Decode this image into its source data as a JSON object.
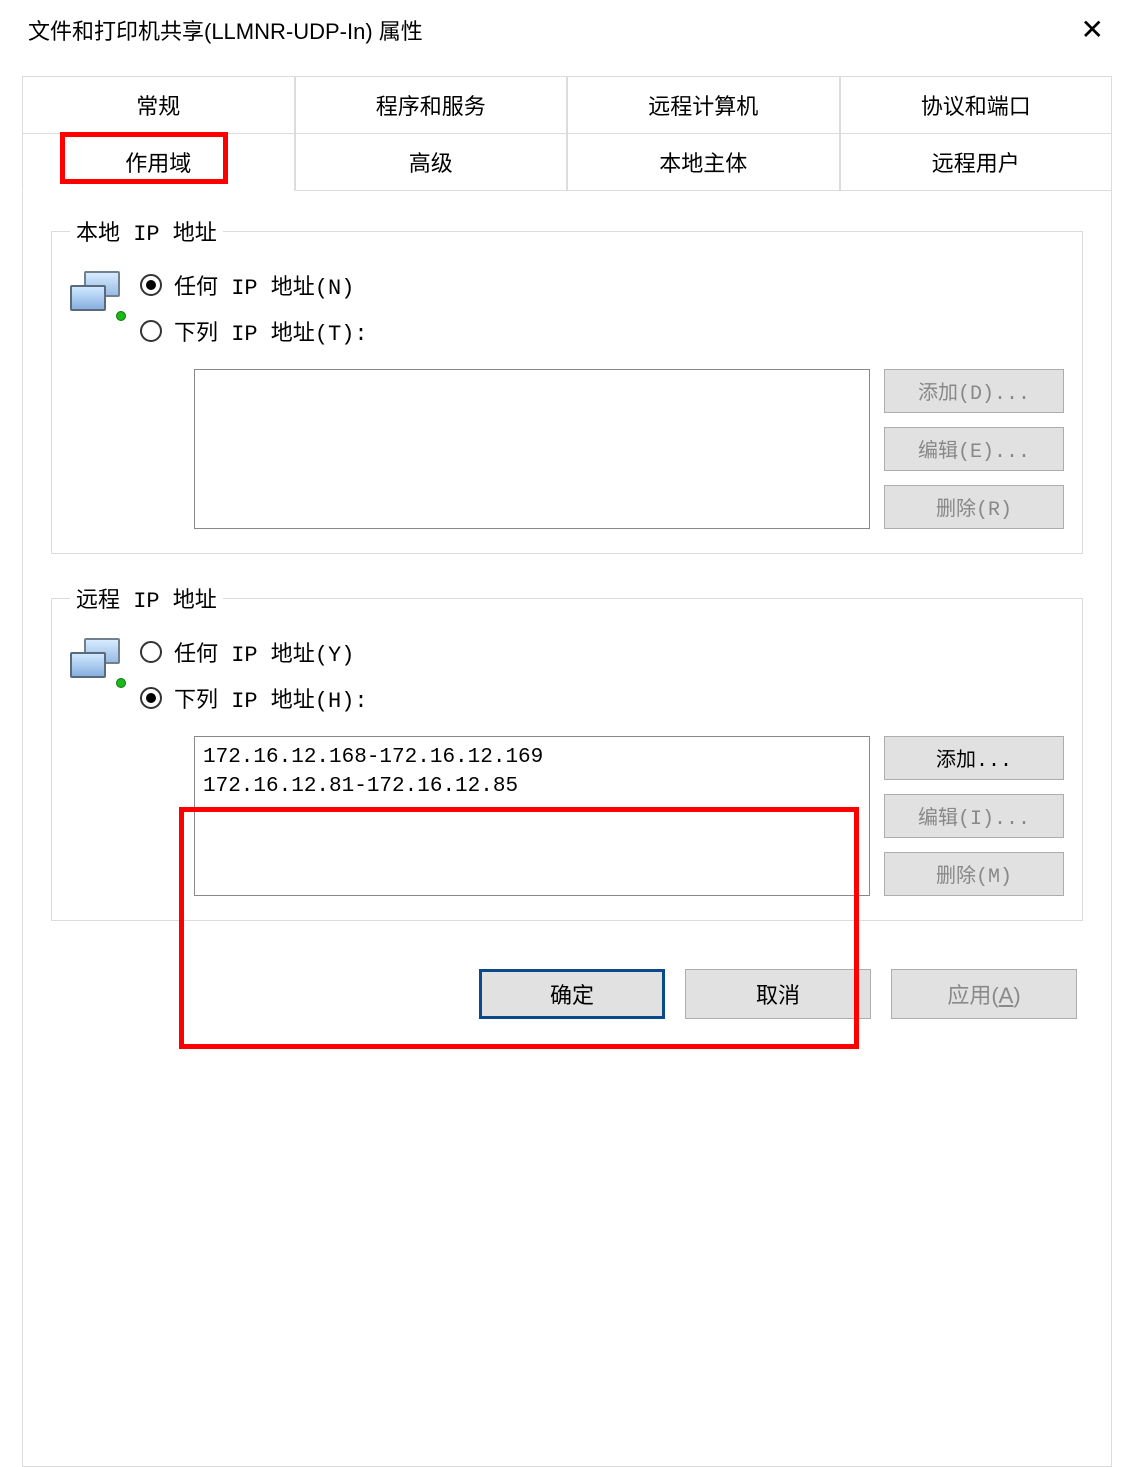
{
  "window": {
    "title": "文件和打印机共享(LLMNR-UDP-In) 属性",
    "close": "✕"
  },
  "tabs": {
    "row1": {
      "t1": "常规",
      "t2": "程序和服务",
      "t3": "远程计算机",
      "t4": "协议和端口"
    },
    "row2": {
      "t1": "作用域",
      "t2": "高级",
      "t3": "本地主体",
      "t4": "远程用户"
    }
  },
  "local": {
    "legend": "本地 IP 地址",
    "radio_any": "任何 IP 地址(N)",
    "radio_these": "下列 IP 地址(T):",
    "selected": "any",
    "list": "",
    "btn_add": "添加(D)...",
    "btn_edit": "编辑(E)...",
    "btn_del": "删除(R)"
  },
  "remote": {
    "legend": "远程 IP 地址",
    "radio_any": "任何 IP 地址(Y)",
    "radio_these": "下列 IP 地址(H):",
    "selected": "these",
    "list": "172.16.12.168-172.16.12.169\n172.16.12.81-172.16.12.85",
    "btn_add": "添加...",
    "btn_edit": "编辑(I)...",
    "btn_del": "删除(M)"
  },
  "actions": {
    "ok": "确定",
    "cancel": "取消",
    "apply": "应用(A)"
  }
}
